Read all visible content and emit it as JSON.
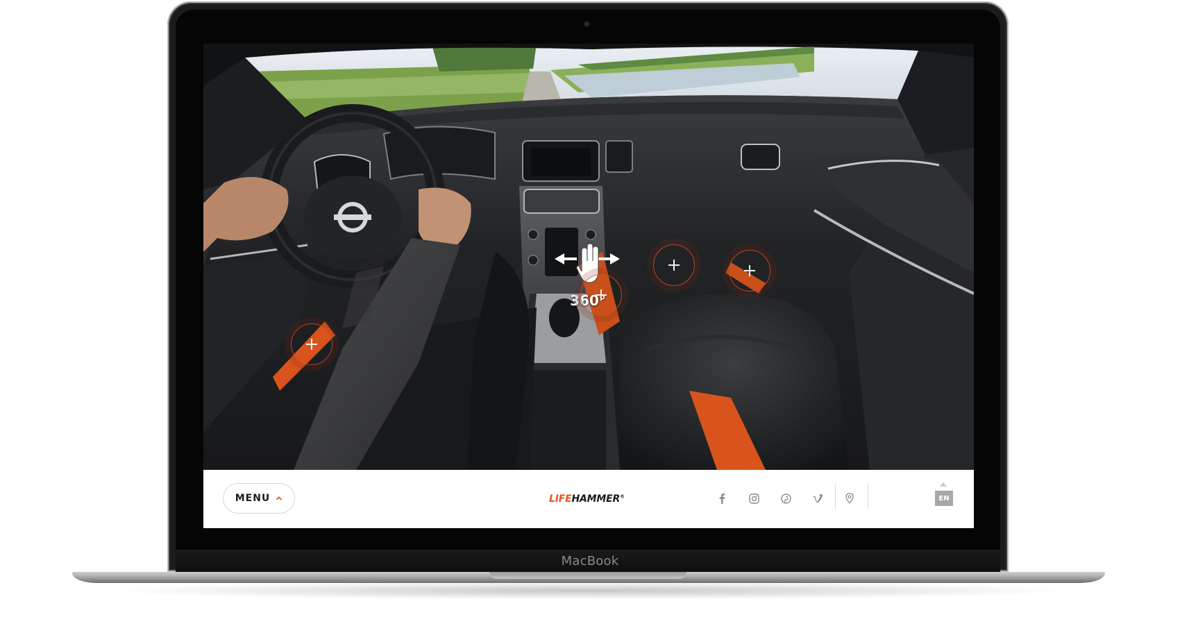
{
  "device": {
    "brand_label": "MacBook"
  },
  "viewer": {
    "pan_indicator": {
      "text": "360°",
      "icon": "hand-drag-icon"
    },
    "hotspots": [
      {
        "name": "hotspot-driver-door",
        "icon": "plus-icon"
      },
      {
        "name": "hotspot-center-console",
        "icon": "plus-icon"
      },
      {
        "name": "hotspot-passenger-footwell",
        "icon": "plus-icon"
      },
      {
        "name": "hotspot-passenger-door",
        "icon": "plus-icon"
      }
    ]
  },
  "footer": {
    "menu": {
      "label": "MENU",
      "icon": "chevron-up-icon"
    },
    "logo": {
      "part1": "LIFE",
      "part2": "HAMMER",
      "mark": "®"
    },
    "social": [
      {
        "name": "facebook-icon"
      },
      {
        "name": "instagram-icon"
      },
      {
        "name": "pinterest-icon"
      },
      {
        "name": "vimeo-icon"
      }
    ],
    "location_icon": "map-pin-icon",
    "language": "EN"
  },
  "colors": {
    "accent": "#e4561d",
    "lang_badge": "#a7a7a7",
    "footer_bg": "#ffffff"
  }
}
